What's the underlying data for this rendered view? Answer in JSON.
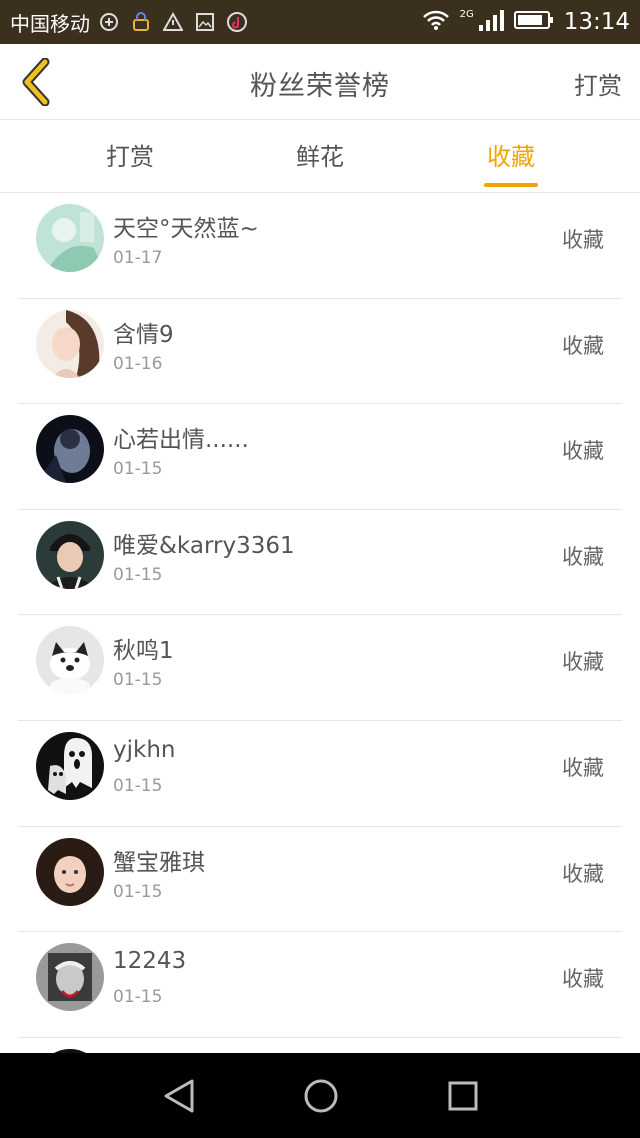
{
  "status_bar": {
    "carrier": "中国移动",
    "network": "2G",
    "time": "13:14"
  },
  "header": {
    "title": "粉丝荣誉榜",
    "right_action": "打赏",
    "accent_color": "#f0a500"
  },
  "tabs": [
    {
      "label": "打赏",
      "active": false
    },
    {
      "label": "鲜花",
      "active": false
    },
    {
      "label": "收藏",
      "active": true
    }
  ],
  "fans": [
    {
      "name": "天空°天然蓝~",
      "date": "01-17",
      "action": "收藏"
    },
    {
      "name": "含情9",
      "date": "01-16",
      "action": "收藏"
    },
    {
      "name": "心若出情......",
      "date": "01-15",
      "action": "收藏"
    },
    {
      "name": "唯爱&karry3361",
      "date": "01-15",
      "action": "收藏"
    },
    {
      "name": "秋鸣1",
      "date": "01-15",
      "action": "收藏"
    },
    {
      "name": "yjkhn",
      "date": "01-15",
      "action": "收藏"
    },
    {
      "name": "蟹宝雅琪",
      "date": "01-15",
      "action": "收藏"
    },
    {
      "name": "12243",
      "date": "01-15",
      "action": "收藏"
    }
  ]
}
